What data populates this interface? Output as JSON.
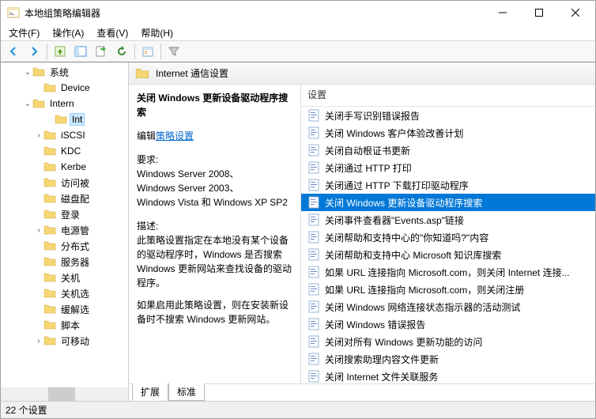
{
  "window": {
    "title": "本地组策略编辑器"
  },
  "menu": {
    "file": "文件(F)",
    "action": "操作(A)",
    "view": "查看(V)",
    "help": "帮助(H)"
  },
  "tree": {
    "items": [
      {
        "indent": 2,
        "exp": "⌄",
        "label": "系统"
      },
      {
        "indent": 3,
        "exp": "",
        "label": "Device"
      },
      {
        "indent": 2,
        "exp": "⌄",
        "label": "Intern"
      },
      {
        "indent": 4,
        "exp": "",
        "label": "Int",
        "selected": true
      },
      {
        "indent": 3,
        "exp": "›",
        "label": "iSCSI"
      },
      {
        "indent": 3,
        "exp": "",
        "label": "KDC"
      },
      {
        "indent": 3,
        "exp": "",
        "label": "Kerbe"
      },
      {
        "indent": 3,
        "exp": "",
        "label": "访问被"
      },
      {
        "indent": 3,
        "exp": "",
        "label": "磁盘配"
      },
      {
        "indent": 3,
        "exp": "",
        "label": "登录"
      },
      {
        "indent": 3,
        "exp": "›",
        "label": "电源管"
      },
      {
        "indent": 3,
        "exp": "",
        "label": "分布式"
      },
      {
        "indent": 3,
        "exp": "",
        "label": "服务器"
      },
      {
        "indent": 3,
        "exp": "",
        "label": "关机"
      },
      {
        "indent": 3,
        "exp": "",
        "label": "关机选"
      },
      {
        "indent": 3,
        "exp": "",
        "label": "缓解选"
      },
      {
        "indent": 3,
        "exp": "",
        "label": "脚本"
      },
      {
        "indent": 3,
        "exp": "›",
        "label": "可移动"
      }
    ]
  },
  "header": {
    "title": "Internet 通信设置"
  },
  "desc": {
    "title": "关闭 Windows 更新设备驱动程序搜索",
    "edit_prefix": "编辑",
    "edit_link": "策略设置",
    "req_label": "要求:",
    "req1": "Windows Server 2008、",
    "req2": "Windows Server 2003、",
    "req3": "Windows Vista 和 Windows XP SP2",
    "desc_label": "描述:",
    "desc_body": "此策略设置指定在本地没有某个设备的驱动程序时，Windows 是否搜索 Windows 更新网站来查找设备的驱动程序。",
    "desc_body2": "如果启用此策略设置，则在安装新设备时不搜索 Windows 更新网站。"
  },
  "list": {
    "header": "设置",
    "items": [
      "关闭手写识别错误报告",
      "关闭 Windows 客户体验改善计划",
      "关闭自动根证书更新",
      "关闭通过 HTTP 打印",
      "关闭通过 HTTP 下载打印驱动程序",
      "关闭 Windows 更新设备驱动程序搜索",
      "关闭事件查看器\"Events.asp\"链接",
      "关闭帮助和支持中心的\"你知道吗?\"内容",
      "关闭帮助和支持中心 Microsoft 知识库搜索",
      "如果 URL 连接指向 Microsoft.com，则关闭 Internet 连接...",
      "如果 URL 连接指向 Microsoft.com，则关闭注册",
      "关闭 Windows 网络连接状态指示器的活动测试",
      "关闭 Windows 错误报告",
      "关闭对所有 Windows 更新功能的访问",
      "关闭搜索助理内容文件更新",
      "关闭 Internet 文件关联服务"
    ],
    "selected_index": 5
  },
  "tabs": {
    "extended": "扩展",
    "standard": "标准"
  },
  "status": {
    "text": "22 个设置"
  }
}
